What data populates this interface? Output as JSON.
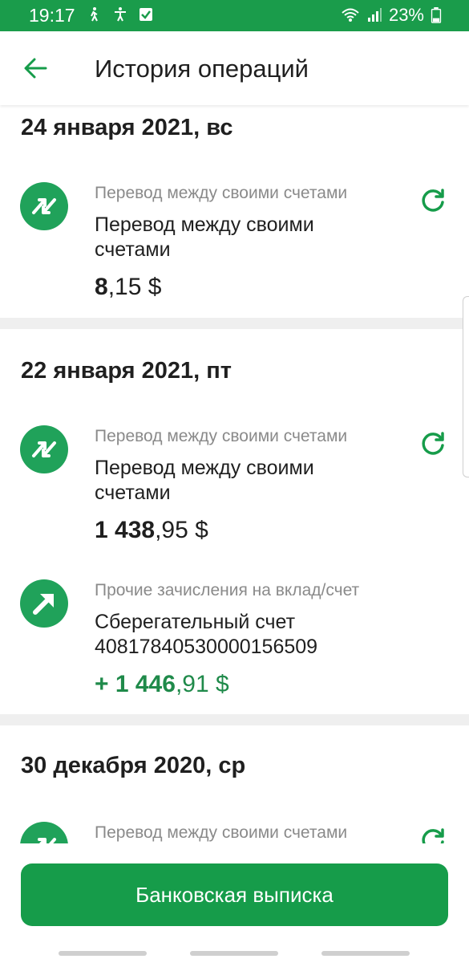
{
  "status_bar": {
    "time": "19:17",
    "battery": "23%"
  },
  "app_bar": {
    "title": "История операций"
  },
  "sections": [
    {
      "date": "24 января 2021, вс",
      "operations": [
        {
          "category": "Перевод между своими счетами",
          "description": "Перевод между своими счетами",
          "amount_int": "8",
          "amount_rest": ",15 $",
          "icon": "transfer-icon",
          "repeat": true
        }
      ]
    },
    {
      "date": "22 января 2021, пт",
      "operations": [
        {
          "category": "Перевод между своими счетами",
          "description": "Перевод между своими счетами",
          "amount_int": "1 438",
          "amount_rest": ",95 $",
          "icon": "transfer-icon",
          "repeat": true
        },
        {
          "category": "Прочие зачисления на вклад/счет",
          "description": "Сберегательный счет 40817840530000156509",
          "amount_int": "+ 1 446",
          "amount_rest": ",91 $",
          "icon": "income-arrow-icon",
          "repeat": false
        }
      ]
    },
    {
      "date": "30 декабря 2020, ср",
      "operations": [
        {
          "category": "Перевод между своими счетами",
          "icon": "transfer-icon",
          "repeat": true
        }
      ]
    }
  ],
  "bottom": {
    "statement_button": "Банковская выписка"
  },
  "colors": {
    "brand_green": "#1a9c4b",
    "button_green": "#169c4a",
    "income_green": "#1f8a4a",
    "muted_text": "#8a8a8a"
  }
}
